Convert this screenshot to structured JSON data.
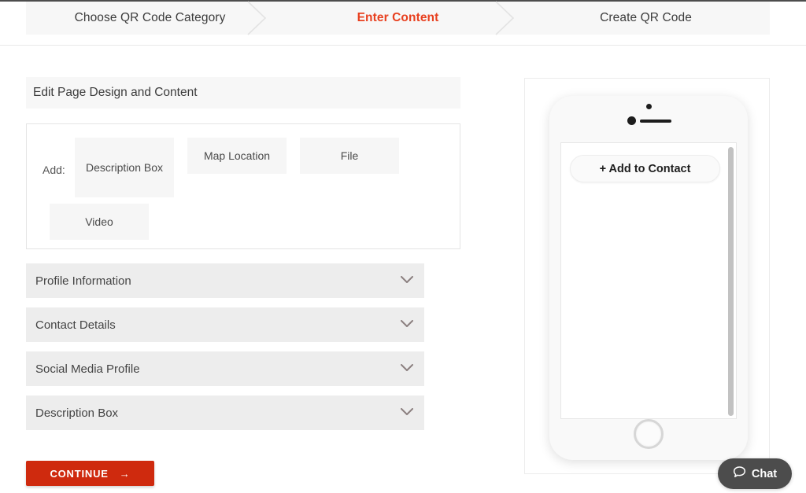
{
  "stepper": {
    "steps": [
      {
        "label": "Choose QR Code Category",
        "state": "completed"
      },
      {
        "label": "Enter Content",
        "state": "active"
      },
      {
        "label": "Create QR Code",
        "state": "upcoming"
      }
    ],
    "active_color": "#e8401f",
    "background": "#f7f7f7"
  },
  "editor": {
    "panel_title": "Edit Page Design and Content",
    "add_label": "Add:",
    "add_buttons": [
      {
        "label": "Description Box"
      },
      {
        "label": "Map Location"
      },
      {
        "label": "File"
      },
      {
        "label": "Video"
      }
    ],
    "accordions": [
      {
        "label": "Profile Information",
        "expanded": false
      },
      {
        "label": "Contact Details",
        "expanded": false
      },
      {
        "label": "Social Media Profile",
        "expanded": false
      },
      {
        "label": "Description Box",
        "expanded": false
      }
    ],
    "continue_button": {
      "label": "CONTINUE",
      "arrow": "→",
      "color": "#cf2a0e"
    }
  },
  "preview": {
    "add_to_contact_label": "+ Add to Contact"
  },
  "chat": {
    "label": "Chat"
  }
}
